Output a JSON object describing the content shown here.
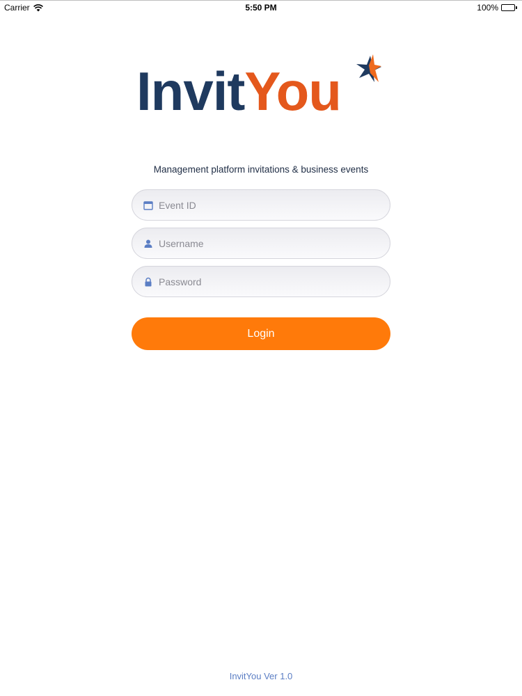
{
  "status_bar": {
    "carrier": "Carrier",
    "time": "5:50 PM",
    "battery": "100%"
  },
  "logo": {
    "part1": "Invit",
    "part2": "You",
    "colors": {
      "invit": "#1f3a5f",
      "you": "#e4581c",
      "star_orange": "#ee6a1e",
      "star_navy": "#1f3a5f"
    }
  },
  "tagline": "Management platform invitations & business events",
  "form": {
    "event_id": {
      "placeholder": "Event ID",
      "value": "",
      "icon": "calendar-icon"
    },
    "username": {
      "placeholder": "Username",
      "value": "",
      "icon": "user-icon"
    },
    "password": {
      "placeholder": "Password",
      "value": "",
      "icon": "lock-icon"
    },
    "login_label": "Login"
  },
  "footer": {
    "version": "InvitYou Ver 1.0"
  },
  "colors": {
    "accent": "#ff7a0a",
    "icon": "#5b7ec4",
    "version_text": "#5b7ec4"
  }
}
